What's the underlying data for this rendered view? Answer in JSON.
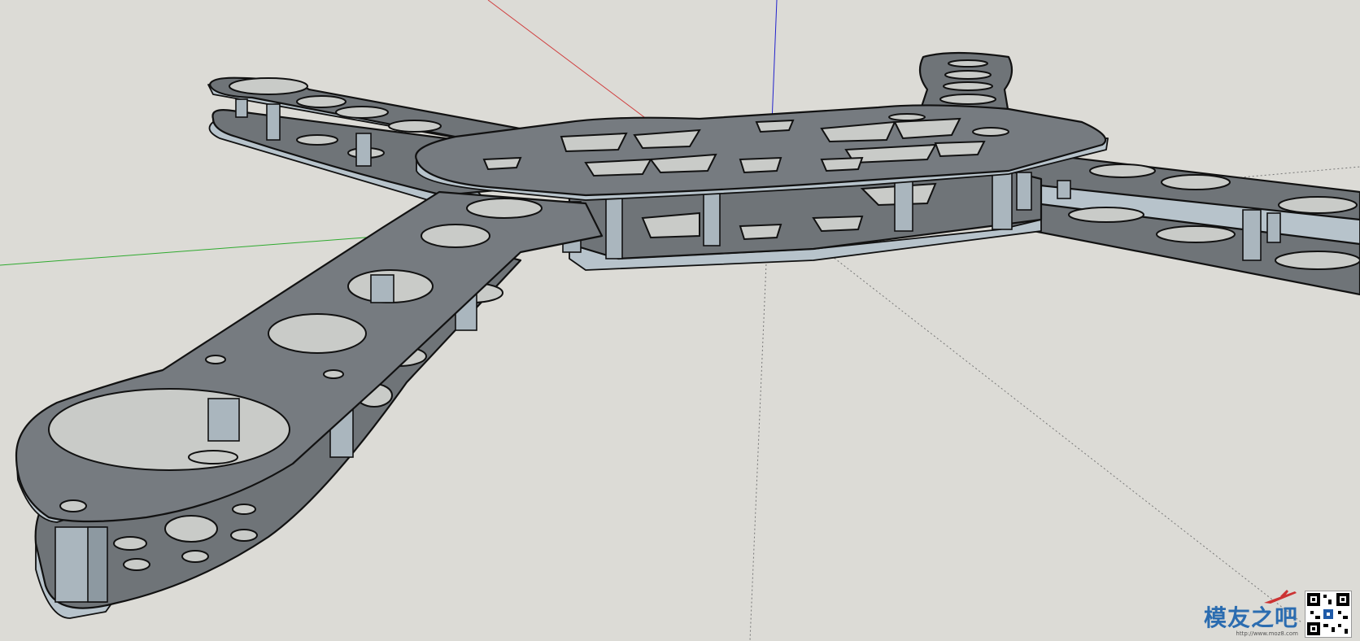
{
  "viewport": {
    "background_color": "#dcdbd6",
    "axis_colors": {
      "red": "#d04040",
      "green": "#2faa2f",
      "blue": "#2222cc"
    },
    "model": {
      "plate_color": "#6f7478",
      "edge_color": "#b7c3cb",
      "outline_color": "#111111"
    }
  },
  "watermark": {
    "brand_text": "模友之吧",
    "url_text": "http://www.moz8.com",
    "logo_icon": "airplane-icon",
    "qr_icon": "qr-code-icon"
  }
}
